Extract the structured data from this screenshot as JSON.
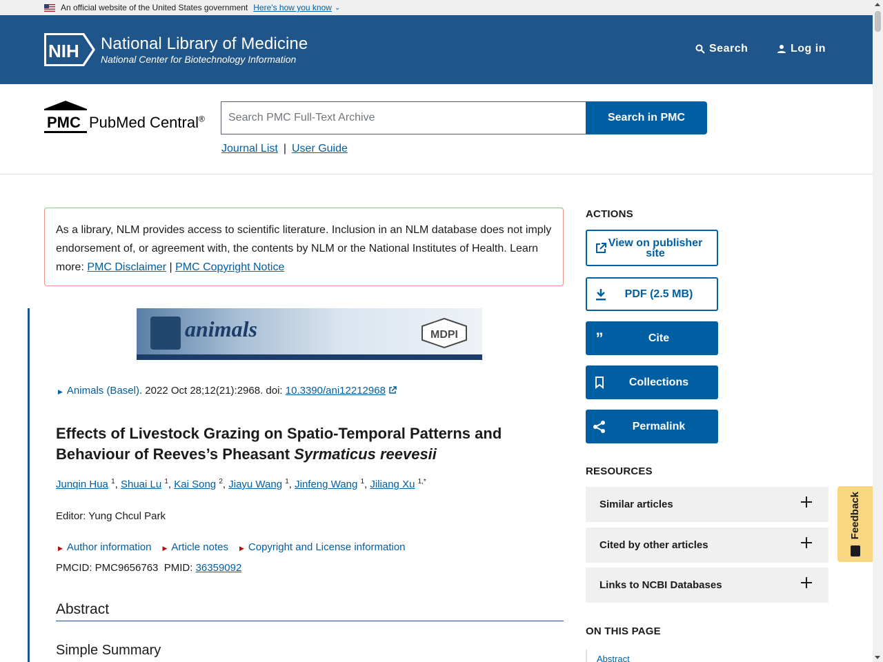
{
  "gov_banner": {
    "text": "An official website of the United States government",
    "link": "Here's how you know"
  },
  "header": {
    "logo_text": "NIH",
    "title": "National Library of Medicine",
    "subtitle": "National Center for Biotechnology Information",
    "search_label": "Search",
    "login_label": "Log in"
  },
  "pmc": {
    "logo_mark": "PMC",
    "logo_name": "PubMed Central",
    "logo_reg": "®",
    "search_placeholder": "Search PMC Full-Text Archive",
    "search_button": "Search in PMC",
    "journal_list": "Journal List",
    "separator": "|",
    "user_guide": "User Guide"
  },
  "disclaimer": {
    "text": "As a library, NLM provides access to scientific literature. Inclusion in an NLM database does not imply endorsement of, or agreement with, the contents by NLM or the National Institutes of Health. Learn more: ",
    "link1": "PMC Disclaimer",
    "sep": " | ",
    "link2": "PMC Copyright Notice"
  },
  "article": {
    "banner_journal": "animals",
    "banner_publisher": "MDPI",
    "journal": "Animals (Basel)",
    "citation": ". 2022 Oct 28;12(21):2968. doi: ",
    "doi": "10.3390/ani12212968",
    "title_main": "Effects of Livestock Grazing on Spatio-Temporal Patterns and Behaviour of Reeves’s Pheasant ",
    "title_species": "Syrmaticus reevesii",
    "authors": [
      {
        "name": "Junqin Hua",
        "sup": "1"
      },
      {
        "name": "Shuai Lu",
        "sup": "1"
      },
      {
        "name": "Kai Song",
        "sup": "2"
      },
      {
        "name": "Jiayu Wang",
        "sup": "1"
      },
      {
        "name": "Jinfeng Wang",
        "sup": "1"
      },
      {
        "name": "Jiliang Xu",
        "sup": "1,*"
      }
    ],
    "editor": "Editor: Yung Chcul Park",
    "meta_links": [
      "Author information",
      "Article notes",
      "Copyright and License information"
    ],
    "pmcid": "PMCID: PMC9656763  PMID: ",
    "pmid": "36359092",
    "abstract_heading": "Abstract",
    "summary_heading": "Simple Summary"
  },
  "sidebar": {
    "actions_heading": "ACTIONS",
    "actions": [
      {
        "label": "View on publisher site"
      },
      {
        "label": "PDF (2.5 MB)"
      },
      {
        "label": "Cite"
      },
      {
        "label": "Collections"
      },
      {
        "label": "Permalink"
      }
    ],
    "resources_heading": "RESOURCES",
    "resources": [
      "Similar articles",
      "Cited by other articles",
      "Links to NCBI Databases"
    ],
    "otp_heading": "ON THIS PAGE",
    "otp_first": "Abstract"
  },
  "feedback": {
    "label": "Feedback"
  },
  "colors": {
    "nih_blue": "#20558a",
    "link_blue": "#005ea2",
    "feedback": "#f9d681",
    "disclaimer_border": "#f2938c"
  }
}
